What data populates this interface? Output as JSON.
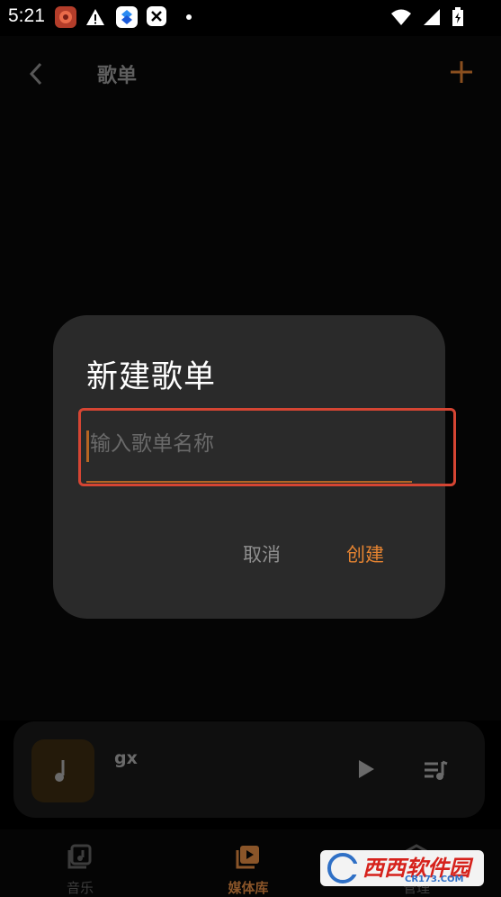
{
  "status_bar": {
    "time": "5:21",
    "icons": [
      "app-notification-icon",
      "warning-icon",
      "blue-app-icon",
      "close-app-icon",
      "dot-icon"
    ],
    "right_icons": [
      "wifi-icon",
      "signal-icon",
      "battery-icon"
    ]
  },
  "app_bar": {
    "title": "歌单",
    "back_icon": "chevron-left-icon",
    "add_icon": "plus-icon"
  },
  "dialog": {
    "title": "新建歌单",
    "input_placeholder": "输入歌单名称",
    "cancel_label": "取消",
    "create_label": "创建",
    "accent_color": "#e68431"
  },
  "mini_player": {
    "track_title": "gx",
    "cover_icon": "music-note-icon",
    "play_icon": "play-icon",
    "queue_icon": "playlist-icon"
  },
  "bottom_nav": {
    "items": [
      {
        "label": "音乐",
        "icon": "music-library-icon",
        "active": false
      },
      {
        "label": "媒体库",
        "icon": "media-library-icon",
        "active": true
      },
      {
        "label": "管理",
        "icon": "manage-icon",
        "active": false
      }
    ]
  },
  "watermark": {
    "text": "西西软件园",
    "sub": "CR173.COM"
  }
}
